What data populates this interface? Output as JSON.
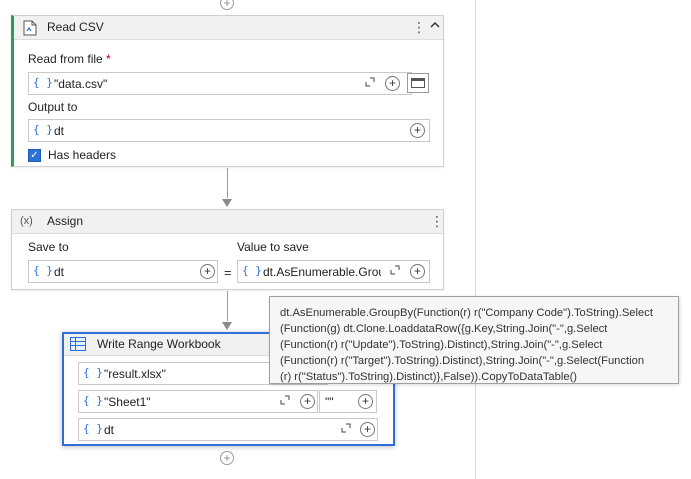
{
  "read_csv": {
    "title": "Read CSV",
    "read_from_file_label": "Read from file",
    "required_mark": "*",
    "read_from_file_value": "\"data.csv\"",
    "output_to_label": "Output to",
    "output_to_value": "dt",
    "has_headers_label": "Has headers",
    "has_headers_checked": true
  },
  "assign": {
    "title": "Assign",
    "icon_text": "(x)",
    "save_to_label": "Save to",
    "save_to_value": "dt",
    "equals_sign": "=",
    "value_to_save_label": "Value to save",
    "value_to_save_value": "dt.AsEnumerable.GroupBy(Function(r) r(\"Company Code\").ToString).Select(Function(g) dt.Clone.LoaddataRow({g.Key,String.Join(\"-\",g.Select(Function(r) r(\"Update\").ToString).Distinct),String.Join(\"-\",g.Select(Function(r) r(\"Target\").ToString).Distinct),String.Join(\"-\",g.Select(Function(r) r(\"Status\").ToString).Distinct)},False)).CopyToDataTable()",
    "value_to_save_display": "dt.AsEnumerable.Grou"
  },
  "tooltip": {
    "text": "dt.AsEnumerable.GroupBy(Function(r) r(\"Company Code\").ToString).Select\n(Function(g) dt.Clone.LoaddataRow({g.Key,String.Join(\"-\",g.Select\n(Function(r) r(\"Update\").ToString).Distinct),String.Join(\"-\",g.Select\n(Function(r) r(\"Target\").ToString).Distinct),String.Join(\"-\",g.Select(Function\n(r) r(\"Status\").ToString).Distinct)},False)).CopyToDataTable()"
  },
  "write_range": {
    "title": "Write Range Workbook",
    "workbook_value": "\"result.xlsx\"",
    "sheet_value": "\"Sheet1\"",
    "start_cell_value": "\"\"",
    "data_value": "dt"
  },
  "glyphs": {
    "brace": "{ }",
    "plus": "+",
    "kebab": "⋮",
    "collapse": "︿",
    "expand": "⤢",
    "check": "✓"
  },
  "icons": {
    "read_csv": "csv-file-icon",
    "assign": "variable-icon",
    "write_range": "table-icon",
    "add": "add-circle-icon"
  },
  "colors": {
    "accent": "#2f6fd6",
    "brace": "#2a72d8",
    "required": "#c00000"
  }
}
